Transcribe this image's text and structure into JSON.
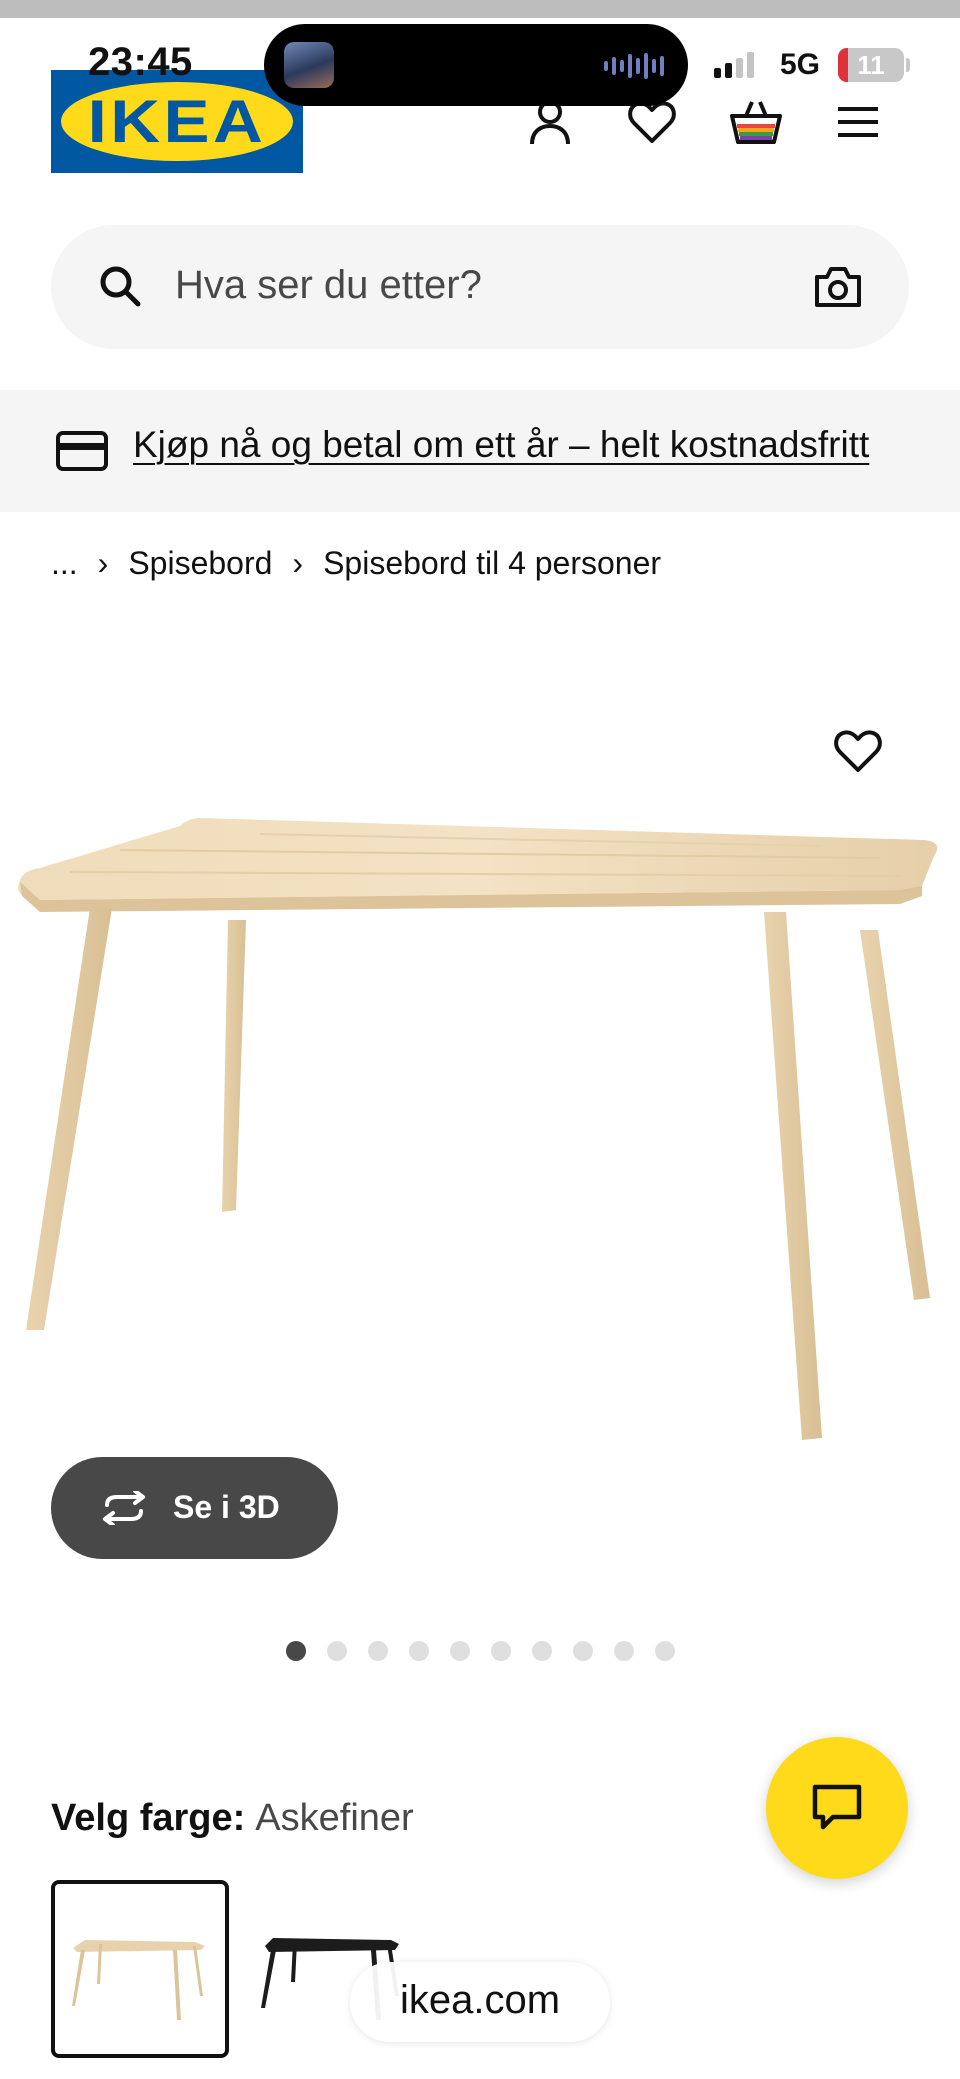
{
  "status_bar": {
    "time": "23:45",
    "network": "5G",
    "battery": "11",
    "signal_bars_active": 2,
    "signal_bars_total": 4
  },
  "header": {
    "logo_text": "IKEA",
    "logo_registered": "®",
    "icons": [
      "user-icon",
      "heart-icon",
      "shopping-bag-icon",
      "menu-icon"
    ]
  },
  "search": {
    "placeholder": "Hva ser du etter?"
  },
  "promo": {
    "text": "Kjøp nå og betal om ett år – helt kostnadsfritt"
  },
  "breadcrumb": {
    "items": [
      "...",
      "Spisebord",
      "Spisebord til 4 personer"
    ]
  },
  "product": {
    "view_3d_label": "Se i 3D",
    "image_count": 10,
    "active_image": 0
  },
  "color": {
    "label": "Velg farge:",
    "value": "Askefiner",
    "options": [
      {
        "name": "Askefiner",
        "color": "#e8d2ae",
        "selected": true
      },
      {
        "name": "black",
        "color": "#1c1c1c",
        "selected": false
      }
    ]
  },
  "browser": {
    "url": "ikea.com"
  },
  "colors": {
    "ikea_blue": "#0058a3",
    "ikea_yellow": "#ffda1a",
    "button_dark": "#484848",
    "wood": "#e8d2ae"
  }
}
